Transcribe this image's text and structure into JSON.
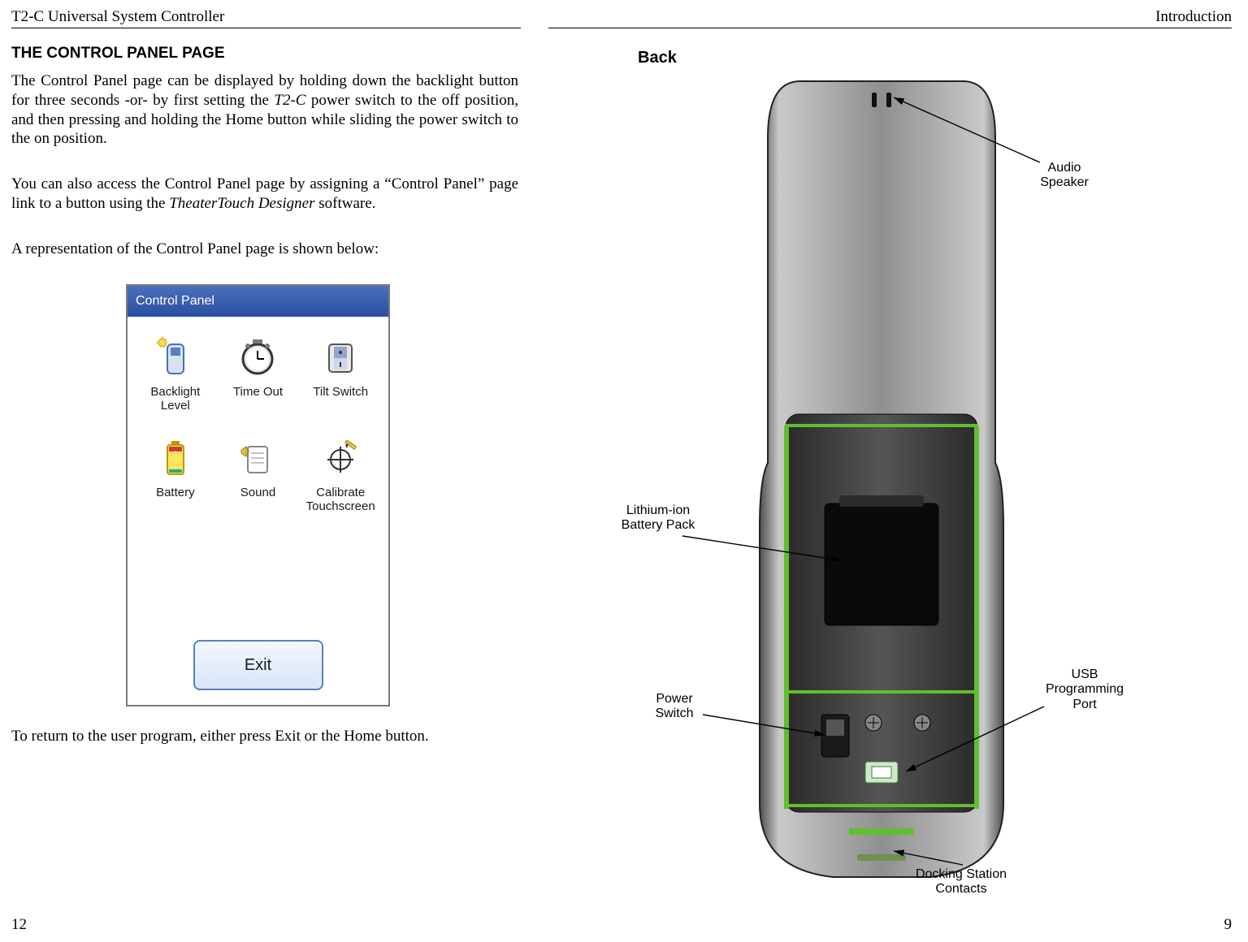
{
  "left": {
    "header_left": "T2-C Universal System Controller",
    "section_heading": "THE CONTROL PANEL PAGE",
    "paragraph1_a": "The Control Panel page can be displayed by holding down the backlight button for three seconds -or- by first setting the ",
    "paragraph1_em1": "T2-C",
    "paragraph1_b": " power switch to the off position, and then pressing and holding the Home button while sliding the power switch to the on position.",
    "paragraph2_a": "You can also access the Control Panel page by assigning a “Control Panel” page link to a button using the ",
    "paragraph2_em": "TheaterTouch Designer",
    "paragraph2_b": " software.",
    "paragraph3": "A representation of the Control Panel page is shown below:",
    "paragraph4": "To return to the user program, either press Exit or the Home button.",
    "footer": "12",
    "cp": {
      "title": "Control Panel",
      "items": [
        "Backlight\nLevel",
        "Time Out",
        "Tilt Switch",
        "Battery",
        "Sound",
        "Calibrate\nTouchscreen"
      ],
      "exit": "Exit"
    }
  },
  "right": {
    "header_right": "Introduction",
    "back_label": "Back",
    "callouts": {
      "audio": "Audio\nSpeaker",
      "battery": "Lithium-ion\nBattery Pack",
      "power": "Power\nSwitch",
      "usb": "USB\nProgramming\nPort",
      "dock": "Docking Station\nContacts"
    },
    "footer": "9"
  }
}
